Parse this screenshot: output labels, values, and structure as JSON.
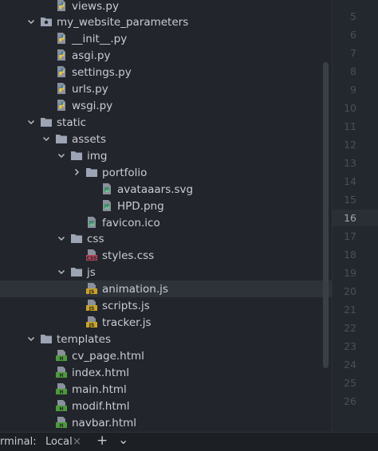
{
  "project_tree": {
    "rows": [
      {
        "label": "views.py",
        "type": "python"
      },
      {
        "label": "my_website_parameters",
        "type": "package",
        "expanded": true
      },
      {
        "label": "__init__.py",
        "type": "python"
      },
      {
        "label": "asgi.py",
        "type": "python"
      },
      {
        "label": "settings.py",
        "type": "python"
      },
      {
        "label": "urls.py",
        "type": "python"
      },
      {
        "label": "wsgi.py",
        "type": "python"
      },
      {
        "label": "static",
        "type": "folder",
        "expanded": true
      },
      {
        "label": "assets",
        "type": "folder",
        "expanded": true
      },
      {
        "label": "img",
        "type": "folder",
        "expanded": true
      },
      {
        "label": "portfolio",
        "type": "folder",
        "expanded": false
      },
      {
        "label": "avataaars.svg",
        "type": "svg"
      },
      {
        "label": "HPD.png",
        "type": "image"
      },
      {
        "label": "favicon.ico",
        "type": "image"
      },
      {
        "label": "css",
        "type": "folder",
        "expanded": true
      },
      {
        "label": "styles.css",
        "type": "css"
      },
      {
        "label": "js",
        "type": "folder",
        "expanded": true
      },
      {
        "label": "animation.js",
        "type": "js",
        "selected": true
      },
      {
        "label": "scripts.js",
        "type": "js"
      },
      {
        "label": "tracker.js",
        "type": "js"
      },
      {
        "label": "templates",
        "type": "folder",
        "expanded": true
      },
      {
        "label": "cv_page.html",
        "type": "html"
      },
      {
        "label": "index.html",
        "type": "html"
      },
      {
        "label": "main.html",
        "type": "html"
      },
      {
        "label": "modif.html",
        "type": "html"
      },
      {
        "label": "navbar.html",
        "type": "html"
      }
    ]
  },
  "gutter": {
    "line_numbers": [
      "5",
      "6",
      "7",
      "8",
      "9",
      "10",
      "11",
      "12",
      "13",
      "14",
      "15",
      "16",
      "17",
      "18",
      "19",
      "20",
      "21",
      "22",
      "23",
      "24",
      "25",
      "26"
    ],
    "current_line": "16"
  },
  "bottom_bar": {
    "terminal_label": "rminal:",
    "tab_local": "Local",
    "close_glyph": "×",
    "add_glyph": "+",
    "menu_glyph": "⌄"
  },
  "colors": {
    "background": "#22262c",
    "selection": "#2e333a",
    "folder": "#9da5b4",
    "python_blue": "#3d7ab8",
    "python_yellow": "#f2c53d",
    "js_badge": "#c9a227",
    "css_badge": "#b8455a",
    "html_badge": "#4c9a3a"
  }
}
